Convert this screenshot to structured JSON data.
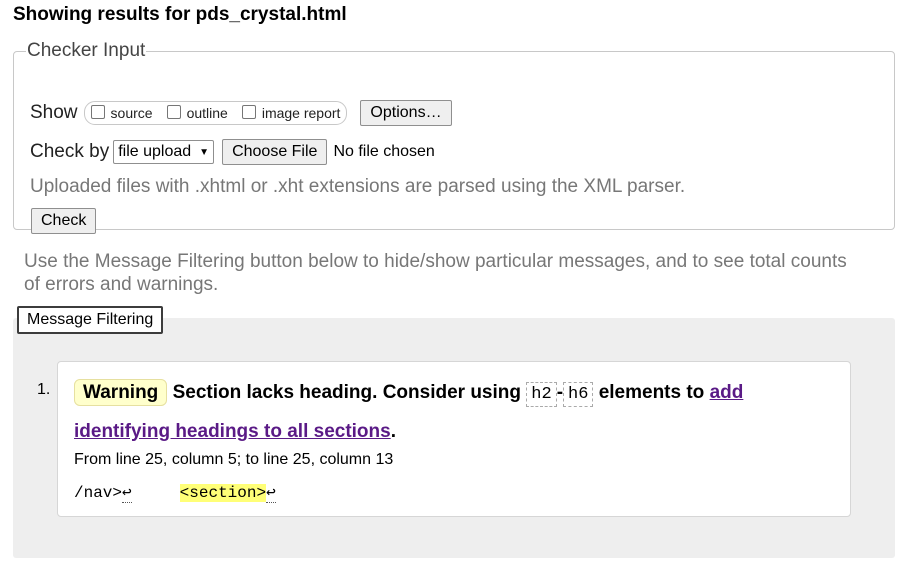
{
  "page": {
    "title": "Showing results for pds_crystal.html"
  },
  "checker": {
    "legend": "Checker Input",
    "show_label": "Show",
    "show_options": [
      "source",
      "outline",
      "image report"
    ],
    "options_button": "Options…",
    "check_by_label": "Check by",
    "check_by_value": "file upload",
    "choose_file_button": "Choose File",
    "file_status": "No file chosen",
    "hint": "Uploaded files with .xhtml or .xht extensions are parsed using the XML parser.",
    "check_button": "Check"
  },
  "info_text": "Use the Message Filtering button below to hide/show particular messages, and to see total counts of errors and warnings.",
  "filter_button": "Message Filtering",
  "results": [
    {
      "number": "1.",
      "type": "Warning",
      "text_before": "Section lacks heading. Consider using",
      "code_a": "h2",
      "dash": "-",
      "code_b": "h6",
      "text_mid": "elements to",
      "link": "add identifying headings to all sections",
      "text_end": ".",
      "location": "From line 25, column 5; to line 25, column 13",
      "extract_pre": "/nav>",
      "extract_hl": "<section>",
      "linefeed": "↩"
    }
  ]
}
